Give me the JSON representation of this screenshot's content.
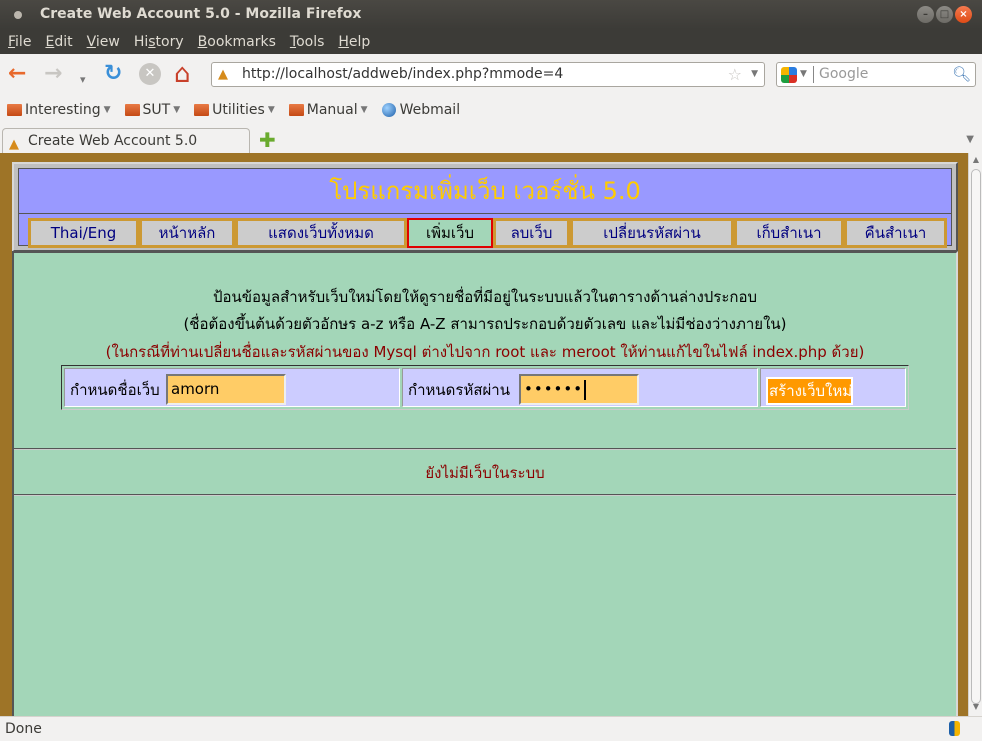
{
  "window": {
    "title": "Create Web Account 5.0 - Mozilla Firefox",
    "controls": [
      "minimize",
      "maximize",
      "close"
    ]
  },
  "menubar": {
    "items": [
      {
        "label": "File",
        "accel": "F"
      },
      {
        "label": "Edit",
        "accel": "E"
      },
      {
        "label": "View",
        "accel": "V"
      },
      {
        "label": "History",
        "accel": "s"
      },
      {
        "label": "Bookmarks",
        "accel": "B"
      },
      {
        "label": "Tools",
        "accel": "T"
      },
      {
        "label": "Help",
        "accel": "H"
      }
    ]
  },
  "navigation": {
    "back_icon": "←",
    "forward_icon": "→",
    "history_dropdown_icon": "▾",
    "reload_icon": "↻",
    "stop_icon": "✕",
    "home_icon": "⌂",
    "url": "http://localhost/addweb/index.php?mmode=4",
    "search_placeholder": "Google"
  },
  "bookmarks": [
    {
      "label": "Interesting",
      "type": "folder"
    },
    {
      "label": "SUT",
      "type": "folder"
    },
    {
      "label": "Utilities",
      "type": "folder"
    },
    {
      "label": "Manual",
      "type": "folder"
    },
    {
      "label": "Webmail",
      "type": "link"
    }
  ],
  "tabs": [
    {
      "label": "Create Web Account 5.0",
      "active": true
    }
  ],
  "page": {
    "title": "โปรแกรมเพิ่มเว็บ เวอร์ชั่น 5.0",
    "nav": [
      {
        "label": "Thai/Eng",
        "active": false
      },
      {
        "label": "หน้าหลัก",
        "active": false
      },
      {
        "label": "แสดงเว็บทั้งหมด",
        "active": false
      },
      {
        "label": "เพิ่มเว็บ",
        "active": true
      },
      {
        "label": "ลบเว็บ",
        "active": false
      },
      {
        "label": "เปลี่ยนรหัสผ่าน",
        "active": false
      },
      {
        "label": "เก็บสำเนา",
        "active": false
      },
      {
        "label": "คืนสำเนา",
        "active": false
      }
    ],
    "instructions": [
      "ป้อนข้อมูลสำหรับเว็บใหม่โดยให้ดูรายชื่อที่มีอยู่ในระบบแล้วในตารางด้านล่างประกอบ",
      "(ชื่อต้องขึ้นต้นด้วยตัวอักษร a-z หรือ A-Z สามารถประกอบด้วยตัวเลข และไม่มีช่องว่างภายใน)",
      "(ในกรณีที่ท่านเปลี่ยนชื่อและรหัสผ่านของ Mysql ต่างไปจาก root และ meroot ให้ท่านแก้ไขในไฟล์ index.php ด้วย)"
    ],
    "form": {
      "name_label": "กำหนดชื่อเว็บ",
      "name_value": "amorn",
      "password_label": "กำหนดรหัสผ่าน",
      "password_masked": "••••••",
      "submit_label": "สร้างเว็บใหม่"
    },
    "empty_message": "ยังไม่มีเว็บในระบบ"
  },
  "status": {
    "text": "Done"
  },
  "colors": {
    "page_frame": "#9e7427",
    "header_bg": "#9999ff",
    "title_text": "#ffcc00",
    "nav_bg": "#cccccc",
    "nav_border": "#cc9933",
    "nav_active_border": "#e00000",
    "content_bg": "#a3d6b8",
    "form_cell_bg": "#ccccff",
    "input_bg": "#ffcc66",
    "submit_bg": "#ff9900",
    "warning_text": "#8b0000"
  }
}
